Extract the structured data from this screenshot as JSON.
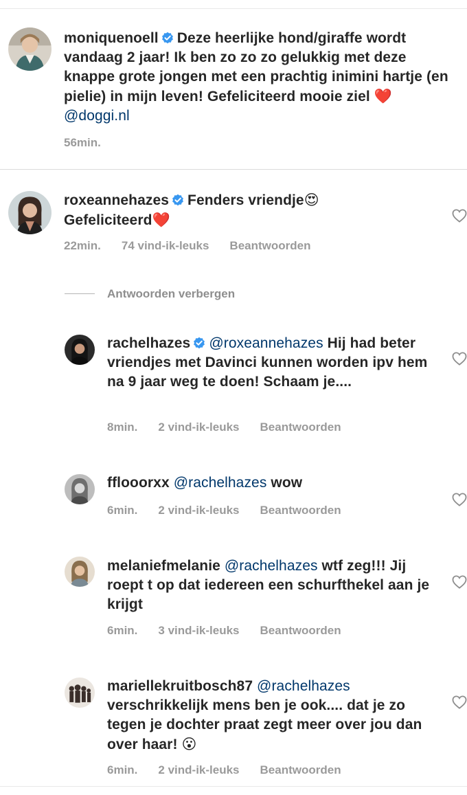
{
  "caption": {
    "username": "moniquenoell",
    "verified": true,
    "text": "Deze heerlijke hond/giraffe wordt vandaag 2 jaar! Ik ben zo zo zo gelukkig met deze knappe grote jongen met een prachtig inimini hartje (en pielie) in mijn leven! Gefeliciteerd mooie ziel",
    "emoji": "❤️",
    "mention": "@doggi.nl",
    "time": "56min."
  },
  "comments": [
    {
      "username": "roxeannehazes",
      "verified": true,
      "text_before": "Fenders vriendje",
      "emoji_1": "😍",
      "text_after": "Gefeliciteerd",
      "emoji_2": "❤️",
      "time": "22min.",
      "likes": "74 vind-ik-leuks",
      "reply_label": "Beantwoorden"
    }
  ],
  "hide_replies_label": "Antwoorden verbergen",
  "replies": [
    {
      "username": "rachelhazes",
      "verified": true,
      "mention": "@roxeannehazes",
      "text": "Hij had beter vriendjes met Davinci kunnen worden ipv hem na 9 jaar weg te doen! Schaam je....",
      "time": "8min.",
      "likes": "2 vind-ik-leuks",
      "reply_label": "Beantwoorden"
    },
    {
      "username": "fflooorxx",
      "verified": false,
      "mention": "@rachelhazes",
      "text": "wow",
      "time": "6min.",
      "likes": "2 vind-ik-leuks",
      "reply_label": "Beantwoorden"
    },
    {
      "username": "melaniefmelanie",
      "verified": false,
      "mention": "@rachelhazes",
      "text": "wtf zeg!!! Jij roept t op dat iedereen een schurfthekel aan je krijgt",
      "time": "6min.",
      "likes": "3 vind-ik-leuks",
      "reply_label": "Beantwoorden"
    },
    {
      "username": "mariellekruitbosch87",
      "verified": false,
      "mention": "@rachelhazes",
      "text": "verschrikkelijk mens ben je ook.... dat je zo tegen je dochter praat zegt meer over jou dan over haar!",
      "emoji": "😮",
      "time": "6min.",
      "likes": "2 vind-ik-leuks",
      "reply_label": "Beantwoorden"
    }
  ],
  "colors": {
    "text": "#262626",
    "secondary": "#9a9a9a",
    "mention": "#00376b",
    "verified": "#3897f0",
    "heart": "#ed1c24"
  },
  "icons": {
    "verified": "verified-badge-icon",
    "like": "heart-outline-icon"
  }
}
